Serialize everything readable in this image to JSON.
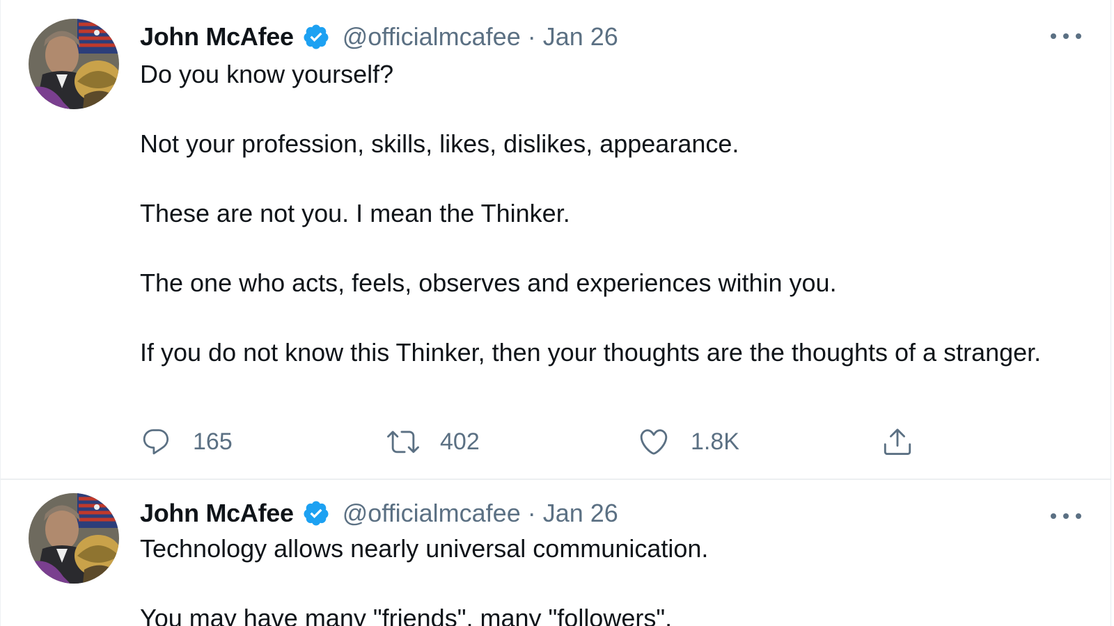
{
  "colors": {
    "text_primary": "#0f1419",
    "text_secondary": "#5b7083",
    "verified_blue": "#1da1f2",
    "divider": "#eceff1"
  },
  "tweets": [
    {
      "author_name": "John McAfee",
      "handle": "@officialmcafee",
      "separator": "·",
      "date": "Jan 26",
      "verified_icon": "verified-badge-icon",
      "more_icon": "more-options-icon",
      "paragraphs": [
        "Do you know yourself?",
        "Not your profession, skills, likes, dislikes, appearance.",
        "These are not you. I mean the Thinker.",
        "The one who acts, feels, observes and experiences within you.",
        "If you do not know this Thinker, then your thoughts are the thoughts of a stranger."
      ],
      "actions": {
        "reply_count": "165",
        "retweet_count": "402",
        "like_count": "1.8K",
        "icons": [
          "reply-icon",
          "retweet-icon",
          "like-icon",
          "share-icon"
        ]
      }
    },
    {
      "author_name": "John McAfee",
      "handle": "@officialmcafee",
      "separator": "·",
      "date": "Jan 26",
      "verified_icon": "verified-badge-icon",
      "more_icon": "more-options-icon",
      "paragraphs": [
        "Technology allows nearly universal communication.",
        "You may have many \"friends\", many \"followers\"."
      ]
    }
  ]
}
